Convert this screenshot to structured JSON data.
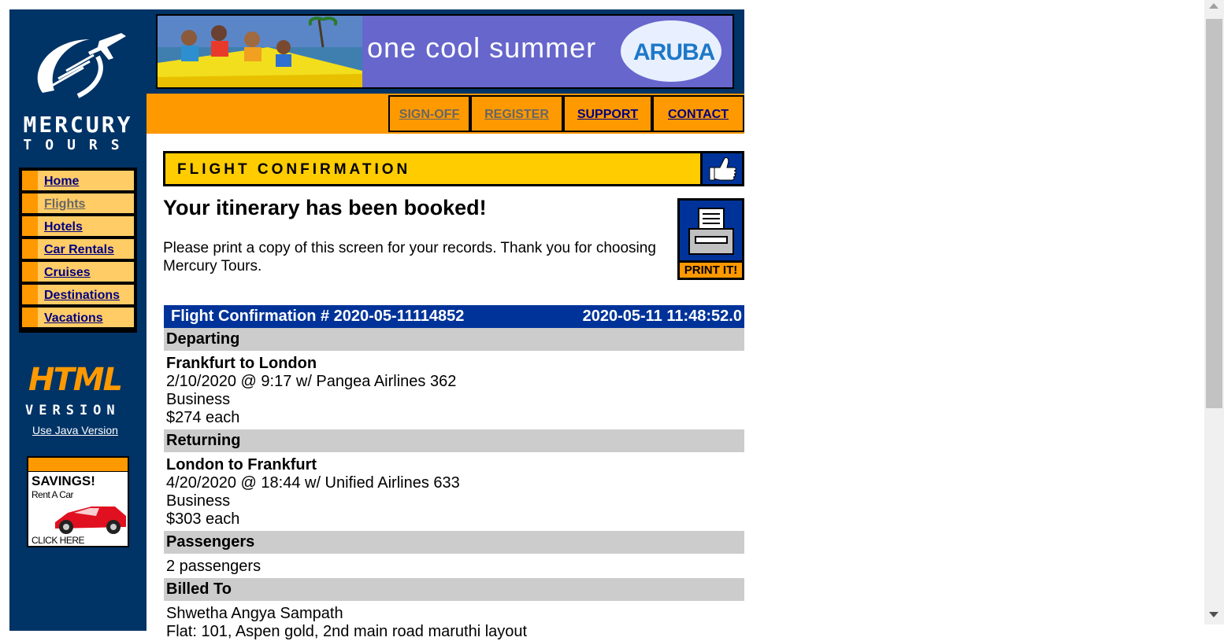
{
  "brand": {
    "logo_line1": "MERCURY",
    "logo_line2": "TOURS"
  },
  "banner": {
    "tagline": "one cool summer",
    "brand": "ARUBA"
  },
  "top_nav": [
    {
      "label": "SIGN-OFF",
      "visited": true
    },
    {
      "label": "REGISTER",
      "visited": true
    },
    {
      "label": "SUPPORT",
      "visited": false
    },
    {
      "label": "CONTACT",
      "visited": false
    }
  ],
  "side_nav": [
    {
      "label": "Home",
      "visited": false
    },
    {
      "label": "Flights",
      "visited": true
    },
    {
      "label": "Hotels",
      "visited": false
    },
    {
      "label": "Car Rentals",
      "visited": false
    },
    {
      "label": "Cruises",
      "visited": false
    },
    {
      "label": "Destinations",
      "visited": false
    },
    {
      "label": "Vacations",
      "visited": false
    }
  ],
  "html_version": {
    "line1": "HTML",
    "line2": "VERSION",
    "java_link": "Use Java Version"
  },
  "promo": {
    "title": "SAVINGS!",
    "subtitle": "Rent A Car",
    "cta": "CLICK HERE"
  },
  "page": {
    "header_title": "FLIGHT CONFIRMATION",
    "booked": "Your itinerary has been booked!",
    "print_message": "Please print a copy of this screen for your records. Thank you for choosing Mercury Tours.",
    "print_button": "PRINT IT!"
  },
  "confirmation": {
    "label": "Flight Confirmation # 2020-05-11114852",
    "timestamp": "2020-05-11 11:48:52.0",
    "departing": {
      "heading": "Departing",
      "route": "Frankfurt to London",
      "flight": "2/10/2020 @ 9:17 w/ Pangea Airlines 362",
      "class": "Business",
      "price": "$274 each"
    },
    "returning": {
      "heading": "Returning",
      "route": "London to Frankfurt",
      "flight": "4/20/2020 @ 18:44 w/ Unified Airlines 633",
      "class": "Business",
      "price": "$303 each"
    },
    "passengers": {
      "heading": "Passengers",
      "value": "2 passengers"
    },
    "billed_to": {
      "heading": "Billed To",
      "name": "Shwetha Angya Sampath",
      "address": "Flat: 101, Aspen gold, 2nd main road maruthi layout"
    }
  },
  "colors": {
    "navy": "#003366",
    "orange": "#FF9900",
    "yellow": "#FFCC00",
    "confirm_blue": "#003399",
    "section_gray": "#CCCCCC"
  }
}
